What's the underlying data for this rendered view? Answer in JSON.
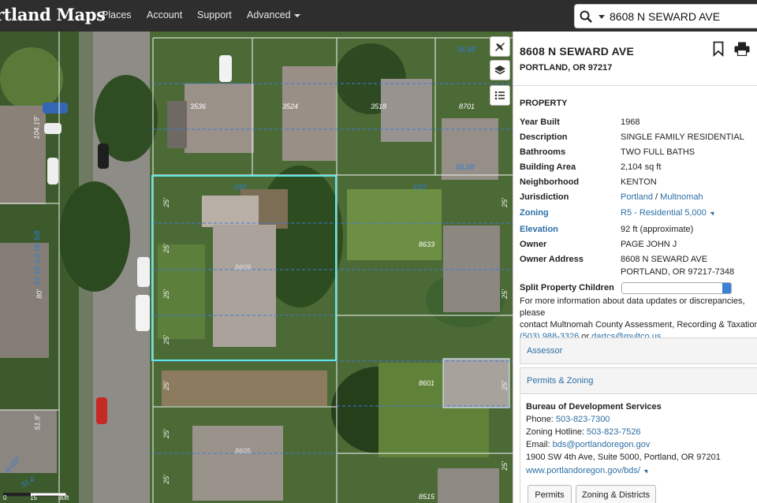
{
  "brand": "rtland Maps",
  "nav": {
    "places": "Places",
    "account": "Account",
    "support": "Support",
    "advanced": "Advanced"
  },
  "search": {
    "value": "8608 N SEWARD AVE",
    "icon": "search-icon"
  },
  "map": {
    "house_numbers": [
      "3536",
      "3524",
      "3518",
      "8701",
      "8633",
      "8601",
      "8515",
      "8609",
      "8605"
    ],
    "dims": [
      "100'",
      "100'",
      "25'",
      "25'",
      "25'",
      "25'",
      "25'",
      "25'",
      "25'",
      "25'",
      "25'",
      "25'",
      "25'",
      "55.58'",
      "55.58'",
      "104.19'",
      "80'",
      "51.9'",
      "R=20'",
      "31.4'",
      "S1 15' 1/2 16' 5/8"
    ],
    "scale": {
      "a": "0",
      "b": "15",
      "c": "30ft"
    }
  },
  "panel": {
    "address": "8608 N SEWARD AVE",
    "city": "PORTLAND, OR 97217",
    "section_title": "PROPERTY",
    "rows": [
      {
        "key": "Year Built",
        "value": "1968"
      },
      {
        "key": "Description",
        "value": "SINGLE FAMILY RESIDENTIAL"
      },
      {
        "key": "Bathrooms",
        "value": "TWO FULL BATHS"
      },
      {
        "key": "Building Area",
        "value": "2,104 sq ft"
      },
      {
        "key": "Neighborhood",
        "value": "KENTON"
      },
      {
        "key": "Jurisdiction",
        "value": "Portland",
        "value2": "Multnomah",
        "sep": " / "
      },
      {
        "key": "Zoning",
        "value": "R5 - Residential 5,000"
      },
      {
        "key": "Elevation",
        "value": "92 ft (approximate)"
      },
      {
        "key": "Owner",
        "value": "PAGE JOHN J"
      },
      {
        "key": "Owner Address",
        "value": "8608 N SEWARD AVE",
        "value2": "PORTLAND, OR 97217-7348"
      }
    ],
    "split_label": "Split Property Children",
    "info_text_1": "For more information about data updates or discrepancies, please",
    "info_text_2": "contact Multnomah County Assessment, Recording & Taxation at",
    "info_phone": "(503) 988-3326",
    "info_or": " or ",
    "info_email": "dartcs@multco.us",
    "info_period": ".",
    "accordion": [
      "Assessor",
      "Permits & Zoning"
    ],
    "bureau": {
      "name": "Bureau of Development Services",
      "phone_label": "Phone: ",
      "phone": "503-823-7300",
      "hotline_label": "Zoning Hotline: ",
      "hotline": "503-823-7526",
      "email_label": "Email: ",
      "email": "bds@portlandoregon.gov",
      "address": "1900 SW 4th Ave, Suite 5000, Portland, OR 97201",
      "website": "www.portlandoregon.gov/bds/"
    },
    "buttons": [
      "Permits",
      "Zoning & Districts"
    ]
  }
}
